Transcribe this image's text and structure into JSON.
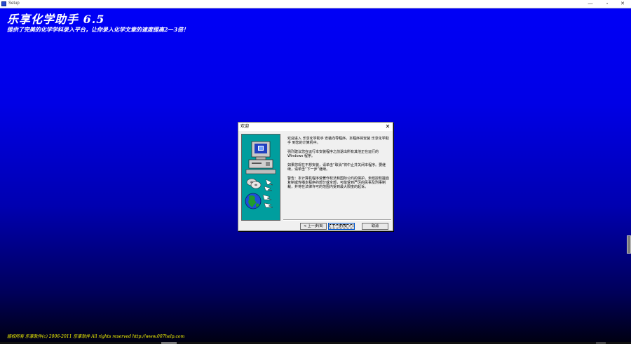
{
  "window": {
    "title": "Setup",
    "minimize": "—",
    "maximize": "▫",
    "close": "✕"
  },
  "banner": {
    "title": "乐享化学助手 6.5",
    "subtitle": "提供了完美的化学学科录入平台，让你录入化学文章的速度提高2—3倍！"
  },
  "footer": {
    "copyright": "版权所有 乐享软件(c) 2006-2011 乐享软件 All rights reserved  http://www.007help.com"
  },
  "dialog": {
    "title": "欢迎",
    "close": "✕",
    "paragraphs": [
      "欢迎进入 乐享化学助手 安装向导程序。本程序将安装 乐享化学助手 到您的计算机中。",
      "强烈建议您在运行本安装程序之前退出所有其他正在运行的 Windows 程序。",
      "如果您现在不想安装，请单击“取消”将中止并关闭本程序。要继续，请单击“下一步”继续。",
      "警告：本计算机程序受著作权法和国际公约的保护。未经授权擅自复制或传播本程序的部分或全部，可能受到严厉的民事及刑事制裁，并将在法律许可的范围内受到最大限度的起诉。"
    ],
    "buttons": {
      "back": "< 上一步(B)",
      "next": "下一步(N) >",
      "cancel": "取消"
    },
    "icons": [
      "computer-icon",
      "disk-icon",
      "globe-icon"
    ]
  },
  "colors": {
    "background_top": "#0000f8",
    "background_bottom": "#000010",
    "banner_text": "#ffffff",
    "footer_text": "#ffff00",
    "side_panel": "#009e9e"
  }
}
